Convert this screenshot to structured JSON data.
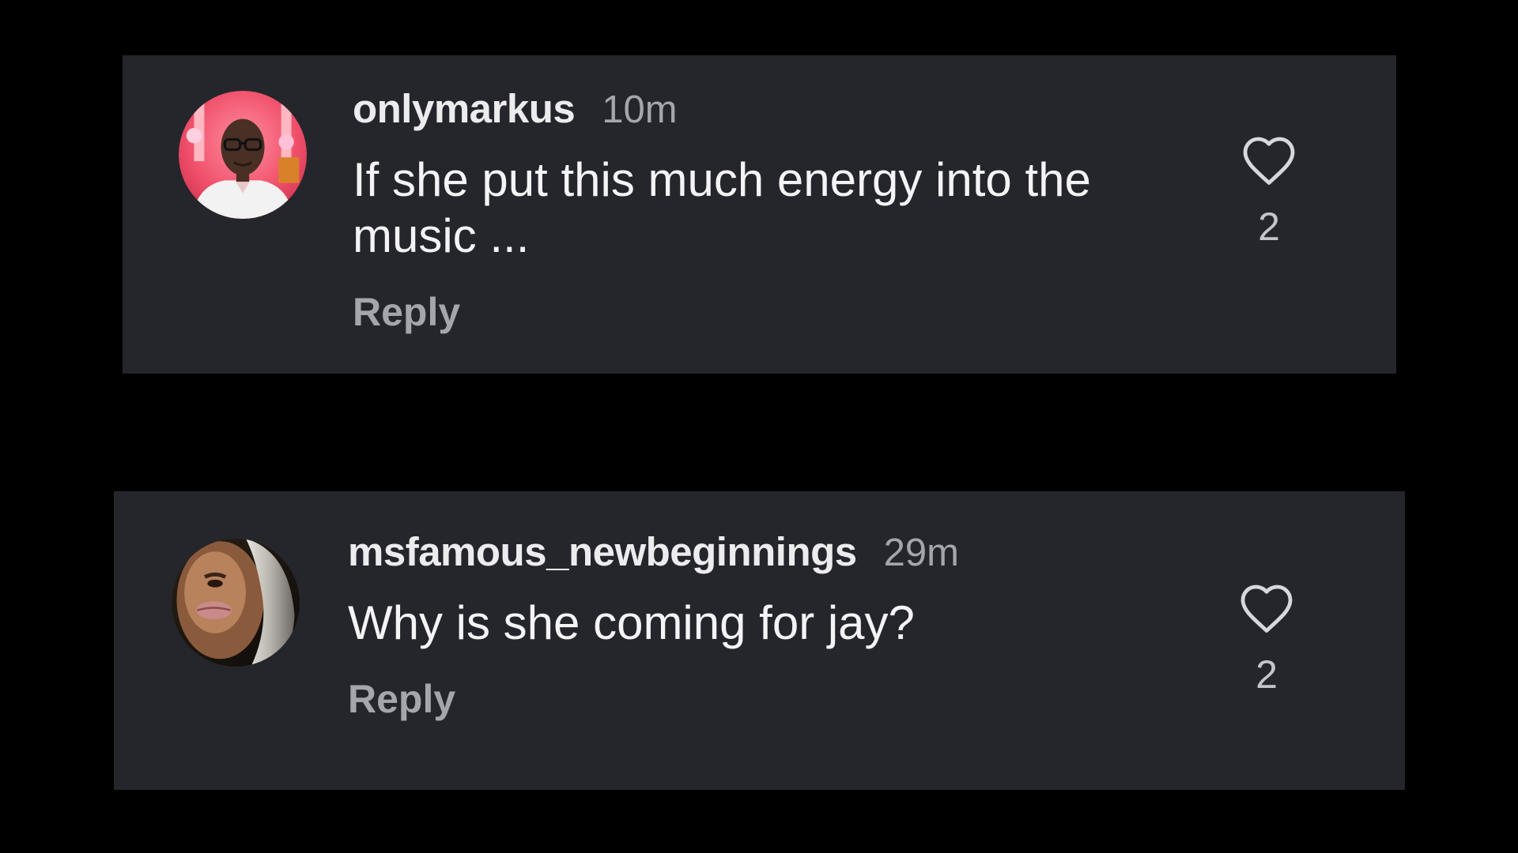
{
  "comments": [
    {
      "username": "onlymarkus",
      "timestamp": "10m",
      "text": "If she put this much energy into the music ...",
      "reply_label": "Reply",
      "like_count": "2",
      "liked": false
    },
    {
      "username": "msfamous_newbeginnings",
      "timestamp": "29m",
      "text": "Why is she coming for jay?",
      "reply_label": "Reply",
      "like_count": "2",
      "liked": false
    }
  ],
  "theme": {
    "page_background": "#000000",
    "card_background": "#25262b",
    "primary_text": "#f4f4f6",
    "secondary_text": "#a3a6ad"
  },
  "icons": {
    "like": "heart-outline-icon"
  }
}
